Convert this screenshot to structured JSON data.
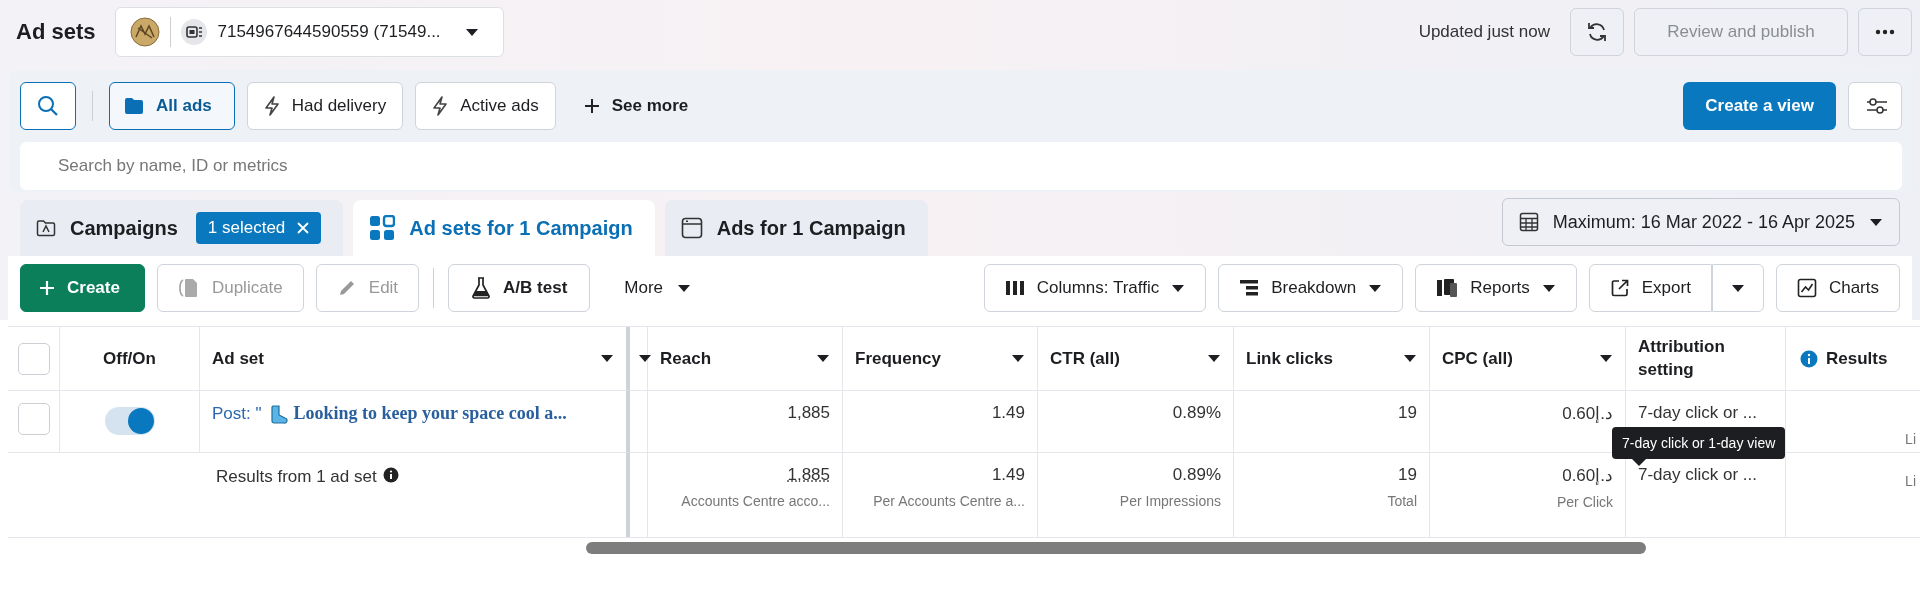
{
  "header": {
    "title": "Ad sets",
    "account": {
      "label": "7154967644590559 (71549..."
    },
    "status": "Updated just now",
    "publish": {
      "label": "Review and publish",
      "disabled": true
    }
  },
  "filters": {
    "chips": [
      {
        "label": "All ads",
        "kind": "folder",
        "selected": true
      },
      {
        "label": "Had delivery",
        "kind": "bolt",
        "selected": false
      },
      {
        "label": "Active ads",
        "kind": "bolt",
        "selected": false
      }
    ],
    "see_more": "See more",
    "create_view": "Create a view",
    "search": {
      "placeholder": "Search by name, ID or metrics"
    }
  },
  "tabs": [
    {
      "label": "Campaigns",
      "kind": "campaigns",
      "badge": "1 selected",
      "selected": false
    },
    {
      "label": "Ad sets for 1 Campaign",
      "kind": "adsets",
      "selected": true
    },
    {
      "label": "Ads for 1 Campaign",
      "kind": "ads",
      "selected": false
    }
  ],
  "date_range": "Maximum: 16 Mar 2022 - 16 Apr 2025",
  "toolbar": {
    "left": [
      {
        "label": "Create",
        "kind": "create",
        "disabled": false
      },
      {
        "label": "Duplicate",
        "kind": "duplicate",
        "disabled": true
      },
      {
        "label": "Edit",
        "kind": "edit",
        "disabled": true
      },
      {
        "label": "A/B test",
        "kind": "abtest",
        "disabled": false
      },
      {
        "label": "More",
        "kind": "more",
        "disabled": false
      }
    ],
    "right": [
      {
        "label": "Columns: Traffic",
        "kind": "columns"
      },
      {
        "label": "Breakdown",
        "kind": "breakdown"
      },
      {
        "label": "Reports",
        "kind": "reports"
      },
      {
        "label": "Export",
        "kind": "export"
      },
      {
        "label": "Charts",
        "kind": "charts"
      }
    ]
  },
  "table": {
    "select_all": {
      "checked": false
    },
    "columns": [
      {
        "kind": "select"
      },
      {
        "kind": "toggle",
        "label": "Off/On"
      },
      {
        "kind": "name",
        "label": "Ad set"
      },
      {
        "kind": "partial"
      },
      {
        "kind": "metric",
        "label": "Reach"
      },
      {
        "kind": "metric",
        "label": "Frequency"
      },
      {
        "kind": "metric",
        "label": "CTR (all)"
      },
      {
        "kind": "metric",
        "label": "Link clicks"
      },
      {
        "kind": "metric",
        "label": "CPC (all)"
      },
      {
        "kind": "text",
        "label": "Attribution setting"
      },
      {
        "kind": "info",
        "label": "Results"
      }
    ],
    "rows": [
      {
        "kind": "item",
        "checked": false,
        "on": true,
        "prefix": "Post: \"",
        "name": "Looking to keep your space cool a...",
        "cells": [
          {
            "value": "1,885"
          },
          {
            "value": "1.49"
          },
          {
            "value": "0.89%"
          },
          {
            "value": "19"
          },
          {
            "value": "د.إ0.60"
          },
          {
            "value": "7-day click or ..."
          },
          {
            "sub": "Li"
          }
        ]
      },
      {
        "kind": "summary",
        "label": "Results from 1 ad set",
        "cells": [
          {
            "value": "1,885",
            "sub": "Accounts Centre acco...",
            "underlined": true
          },
          {
            "value": "1.49",
            "sub": "Per Accounts Centre a..."
          },
          {
            "value": "0.89%",
            "sub": "Per Impressions"
          },
          {
            "value": "19",
            "sub": "Total"
          },
          {
            "value": "د.إ0.60",
            "sub": "Per Click"
          },
          {
            "value": "7-day click or ..."
          },
          {
            "sub": "Li"
          }
        ]
      }
    ],
    "tooltip": {
      "text": "7-day click or 1-day view"
    }
  }
}
